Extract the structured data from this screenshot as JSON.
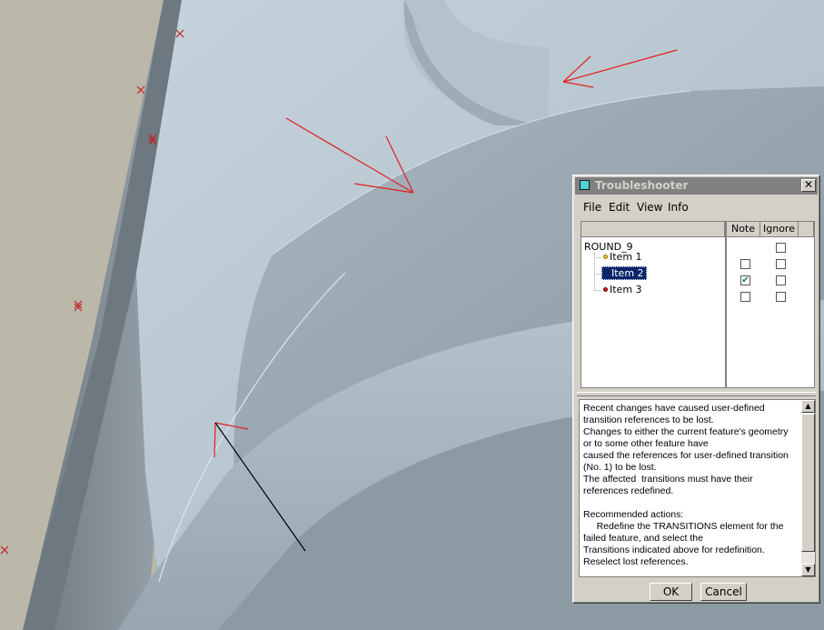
{
  "window": {
    "title": "Troubleshooter",
    "close_glyph": "✕"
  },
  "menu": [
    "File",
    "Edit",
    "View",
    "Info"
  ],
  "columns": {
    "note": "Note",
    "ignore": "Ignore"
  },
  "tree": {
    "root": "ROUND_9",
    "items": [
      {
        "label": "Item 1",
        "dot_color": "#e8c21a",
        "note": false,
        "ignore": false,
        "selected": false
      },
      {
        "label": "Item 2",
        "dot_color": "#e8c21a",
        "note": true,
        "ignore": false,
        "selected": true
      },
      {
        "label": "Item 3",
        "dot_color": "#c0201a",
        "note": false,
        "ignore": false,
        "selected": false
      }
    ]
  },
  "message": "Recent changes have caused user-defined\ntransition references to be lost.\nChanges to either the current feature's geometry\nor to some other feature have\ncaused the references for user-defined transition\n(No. 1) to be lost.\nThe affected  transitions must have their\nreferences redefined.\n\nRecommended actions:\n     Redefine the TRANSITIONS element for the\nfailed feature, and select the\nTransitions indicated above for redefinition.\nReselect lost references.",
  "buttons": {
    "ok": "OK",
    "cancel": "Cancel"
  },
  "colors": {
    "background": "#b9b6a8",
    "surface": "#a6b3bd",
    "annotation": "#e02020"
  }
}
